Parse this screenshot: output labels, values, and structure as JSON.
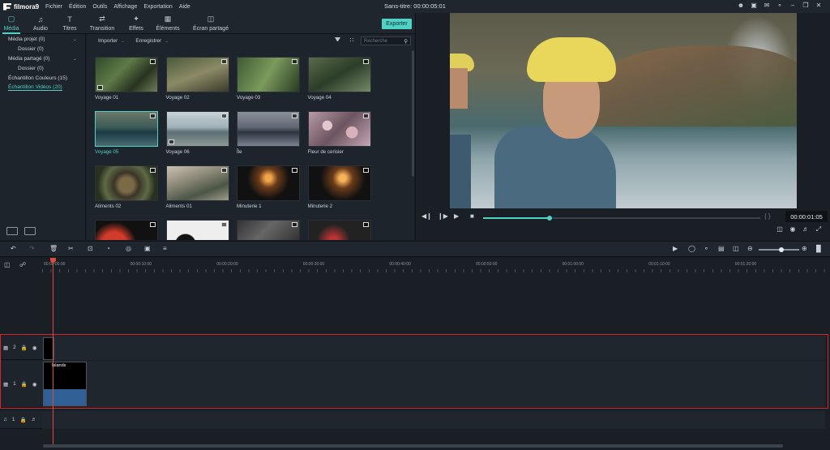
{
  "app": {
    "name": "filmora9",
    "menu": [
      "Fichier",
      "Édition",
      "Outils",
      "Affichage",
      "Exportation",
      "Aide"
    ],
    "project_title": "Sans-titre:",
    "project_time": "00:00:05:01"
  },
  "tabs": [
    {
      "label": "Média",
      "icon": "folder-icon",
      "active": true
    },
    {
      "label": "Audio",
      "icon": "music-note-icon"
    },
    {
      "label": "Titres",
      "icon": "text-icon"
    },
    {
      "label": "Transition",
      "icon": "transition-icon"
    },
    {
      "label": "Effets",
      "icon": "effects-icon"
    },
    {
      "label": "Éléments",
      "icon": "image-icon"
    },
    {
      "label": "Écran partagé",
      "icon": "split-screen-icon"
    }
  ],
  "export_label": "Exporter",
  "tree": [
    {
      "label": "Média projet (0)",
      "indent": 10,
      "chevron": true
    },
    {
      "label": "Dossier (0)",
      "indent": 22
    },
    {
      "label": "Média partagé (0)",
      "indent": 10,
      "chevron": true
    },
    {
      "label": "Dossier (0)",
      "indent": 22
    },
    {
      "label": "Échantillon Couleurs (15)",
      "indent": 10
    },
    {
      "label": "Échantillon Vidéos (20)",
      "indent": 10,
      "selected": true
    }
  ],
  "media_toolbar": {
    "import_label": "Importer",
    "record_label": "Enregistrer",
    "search_placeholder": "Recherche"
  },
  "media": [
    {
      "label": "Voyage 01",
      "style": "i-forest"
    },
    {
      "label": "Voyage 02",
      "style": "i-path"
    },
    {
      "label": "Voyage 03",
      "style": "i-green"
    },
    {
      "label": "Voyage 04",
      "style": "i-forest2"
    },
    {
      "label": "Voyage 05",
      "style": "i-lake",
      "selected": true
    },
    {
      "label": "Voyage 06",
      "style": "i-shore"
    },
    {
      "label": "Île",
      "style": "i-island"
    },
    {
      "label": "Fleur de cerisier",
      "style": "i-cherry"
    },
    {
      "label": "Aliments 02",
      "style": "i-bowl"
    },
    {
      "label": "Aliments 01",
      "style": "i-leaf"
    },
    {
      "label": "Minuterie 1",
      "style": "i-count"
    },
    {
      "label": "Minuterie 2",
      "style": "i-count2"
    },
    {
      "label": "",
      "style": "i-red"
    },
    {
      "label": "",
      "style": "i-white"
    },
    {
      "label": "",
      "style": "i-gray"
    },
    {
      "label": "",
      "style": "i-dark"
    }
  ],
  "preview": {
    "timecode": "00:00:01:05",
    "progress": 0.24,
    "braces": "{ }"
  },
  "ruler_ticks": [
    "00:00:00:00",
    "00:00:10:00",
    "00:00:20:00",
    "00:00:30:00",
    "00:00:40:00",
    "00:00:50:00",
    "00:01:00:00",
    "00:01:10:00",
    "00:01:20:00"
  ],
  "tracks": {
    "v2_label": "2",
    "v1_label": "1",
    "a1_label": "1",
    "clip_v1_name": "Islands"
  },
  "zoom_level": 0.55,
  "colors": {
    "accent": "#4fd1c5",
    "selection_frame": "#d6262b",
    "playhead": "#e04a3a",
    "clip": "#2f5f95"
  }
}
